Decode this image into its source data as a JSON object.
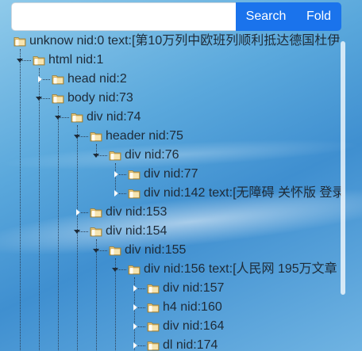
{
  "toolbar": {
    "search_placeholder": "",
    "search_value": "",
    "search_label": "Search",
    "fold_label": "Fold"
  },
  "tree": {
    "nodes": [
      {
        "label": "unknow nid:0 text:[第10万列中欧班列顺利抵达德国杜伊",
        "depth": 0,
        "expanded": true
      },
      {
        "label": "html nid:1",
        "depth": 1,
        "expanded": true
      },
      {
        "label": "head nid:2",
        "depth": 2,
        "expanded": false
      },
      {
        "label": "body nid:73",
        "depth": 2,
        "expanded": true
      },
      {
        "label": "div nid:74",
        "depth": 3,
        "expanded": true
      },
      {
        "label": "header nid:75",
        "depth": 4,
        "expanded": true
      },
      {
        "label": "div nid:76",
        "depth": 5,
        "expanded": true
      },
      {
        "label": "div nid:77",
        "depth": 6,
        "expanded": false
      },
      {
        "label": "div nid:142 text:[无障碍 关怀版 登录",
        "depth": 6,
        "expanded": false
      },
      {
        "label": "div nid:153",
        "depth": 4,
        "expanded": false
      },
      {
        "label": "div nid:154",
        "depth": 4,
        "expanded": true
      },
      {
        "label": "div nid:155",
        "depth": 5,
        "expanded": true
      },
      {
        "label": "div nid:156 text:[人民网 195万文章",
        "depth": 6,
        "expanded": true
      },
      {
        "label": "div nid:157",
        "depth": 7,
        "expanded": false
      },
      {
        "label": "h4 nid:160",
        "depth": 7,
        "expanded": false
      },
      {
        "label": "div nid:164",
        "depth": 7,
        "expanded": false
      },
      {
        "label": "dl nid:174",
        "depth": 7,
        "expanded": false
      }
    ]
  },
  "colors": {
    "button": "#1a73ec",
    "text": "#1e2b38",
    "background": "#5aa8dc"
  },
  "icons": {
    "node_icon": "folder-icon",
    "expanded_toggle": "caret-down-icon",
    "collapsed_toggle": "caret-right-icon"
  }
}
